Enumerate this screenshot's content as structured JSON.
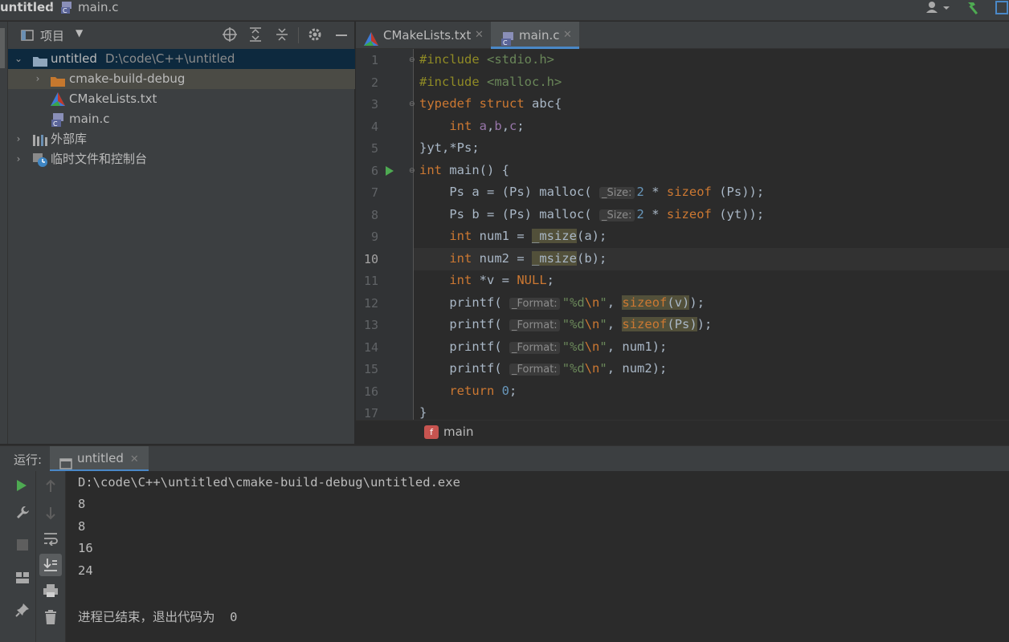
{
  "navbar": {
    "project": "untitled",
    "file": "main.c"
  },
  "project_panel": {
    "title": "项目",
    "tree": [
      {
        "label": "untitled",
        "path": "D:\\code\\C++\\untitled",
        "icon": "folder-icon"
      },
      {
        "label": "cmake-build-debug",
        "icon": "folder-icon"
      },
      {
        "label": "CMakeLists.txt",
        "icon": "cmake-icon"
      },
      {
        "label": "main.c",
        "icon": "c-file-icon"
      },
      {
        "label": "外部库",
        "icon": "library-icon"
      },
      {
        "label": "临时文件和控制台",
        "icon": "scratch-icon"
      }
    ]
  },
  "tabs": [
    {
      "label": "CMakeLists.txt",
      "active": false
    },
    {
      "label": "main.c",
      "active": true
    }
  ],
  "editor": {
    "line_numbers": [
      "1",
      "2",
      "3",
      "4",
      "5",
      "6",
      "7",
      "8",
      "9",
      "10",
      "11",
      "12",
      "13",
      "14",
      "15",
      "16",
      "17"
    ],
    "current_line": "10",
    "hint_size": "_Size:",
    "hint_format": "_Format:",
    "breadcrumb_function": "main",
    "breadcrumb_badge": "f"
  },
  "run": {
    "label": "运行:",
    "tab": "untitled",
    "output": [
      "D:\\code\\C++\\untitled\\cmake-build-debug\\untitled.exe",
      "8",
      "8",
      "16",
      "24",
      "",
      "进程已结束，退出代码为  0"
    ]
  },
  "colors": {
    "keyword": "#cc7832",
    "string": "#6a8759",
    "number": "#6897bb",
    "macro": "#908b25",
    "accent": "#4a88c7"
  }
}
